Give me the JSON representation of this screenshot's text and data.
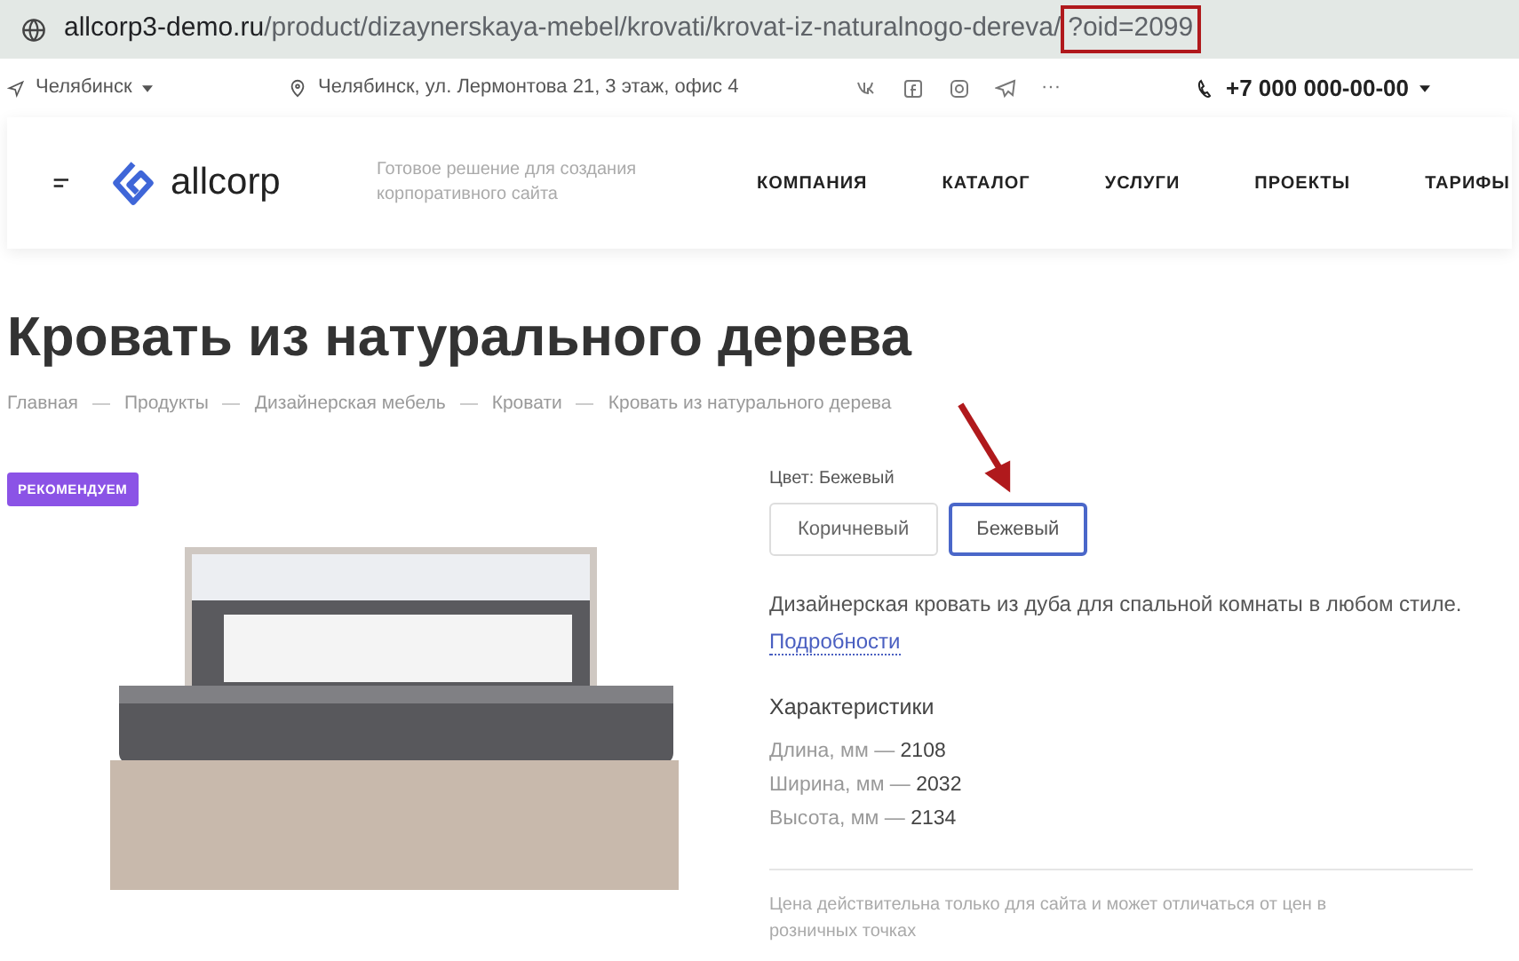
{
  "browser": {
    "url_domain": "allcorp3-demo.ru",
    "url_path": "/product/dizaynerskaya-mebel/krovati/krovat-iz-naturalnogo-dereva/",
    "url_query": "?oid=2099"
  },
  "topbar": {
    "city": "Челябинск",
    "address": "Челябинск, ул. Лермонтова 21, 3 этаж, офис 4",
    "more": "···",
    "phone": "+7 000 000-00-00"
  },
  "header": {
    "logo": "allcorp",
    "tagline": "Готовое решение для создания корпоративного сайта",
    "nav": [
      "КОМПАНИЯ",
      "КАТАЛОГ",
      "УСЛУГИ",
      "ПРОЕКТЫ",
      "ТАРИФЫ"
    ]
  },
  "title": "Кровать из натурального дерева",
  "breadcrumbs": [
    "Главная",
    "Продукты",
    "Дизайнерская мебель",
    "Кровати",
    "Кровать из натурального дерева"
  ],
  "badge": "РЕКОМЕНДУЕМ",
  "color_label": "Цвет: Бежевый",
  "color_options": [
    {
      "label": "Коричневый",
      "selected": false
    },
    {
      "label": "Бежевый",
      "selected": true
    }
  ],
  "description": "Дизайнерская кровать из дуба для спальной комнаты в любом стиле.",
  "details_link": "Подробности",
  "specs_title": "Характеристики",
  "specs": [
    {
      "name": "Длина, мм —",
      "value": "2108"
    },
    {
      "name": "Ширина, мм —",
      "value": "2032"
    },
    {
      "name": "Высота, мм —",
      "value": "2134"
    }
  ],
  "price_note": "Цена действительна только для сайта и может отличаться от цен в розничных точках"
}
